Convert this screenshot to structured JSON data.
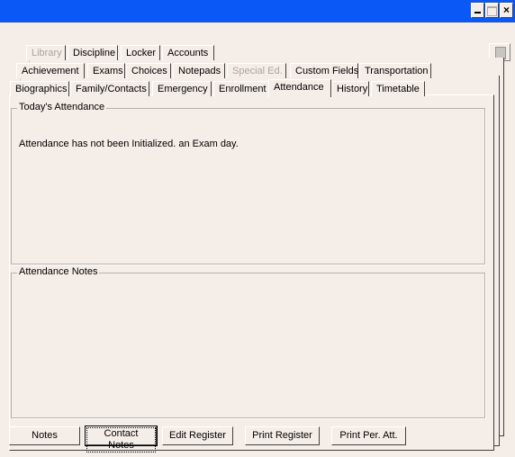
{
  "window": {
    "minimize": "_",
    "close": "×"
  },
  "tabs_row1": [
    {
      "label": "Library",
      "disabled": true
    },
    {
      "label": "Discipline"
    },
    {
      "label": "Locker"
    },
    {
      "label": "Accounts"
    }
  ],
  "tabs_row2": [
    {
      "label": "Achievement"
    },
    {
      "label": "Exams"
    },
    {
      "label": "Choices"
    },
    {
      "label": "Notepads"
    },
    {
      "label": "Special Ed.",
      "disabled": true
    },
    {
      "label": "Custom Fields"
    },
    {
      "label": "Transportation"
    }
  ],
  "tabs_row3": [
    {
      "label": "Biographics"
    },
    {
      "label": "Family/Contacts"
    },
    {
      "label": "Emergency"
    },
    {
      "label": "Enrollment"
    },
    {
      "label": "Attendance",
      "active": true
    },
    {
      "label": "History"
    },
    {
      "label": "Timetable"
    }
  ],
  "today_group": {
    "label": "Today's Attendance",
    "message": "Attendance has not been Initialized. an Exam day."
  },
  "notes_group": {
    "label": "Attendance Notes"
  },
  "buttons": {
    "notes": "Notes",
    "contact_notes": "Contact Notes",
    "edit_register": "Edit Register",
    "print_register": "Print Register",
    "print_per_att": "Print Per. Att."
  },
  "side_icon": "document-icon"
}
